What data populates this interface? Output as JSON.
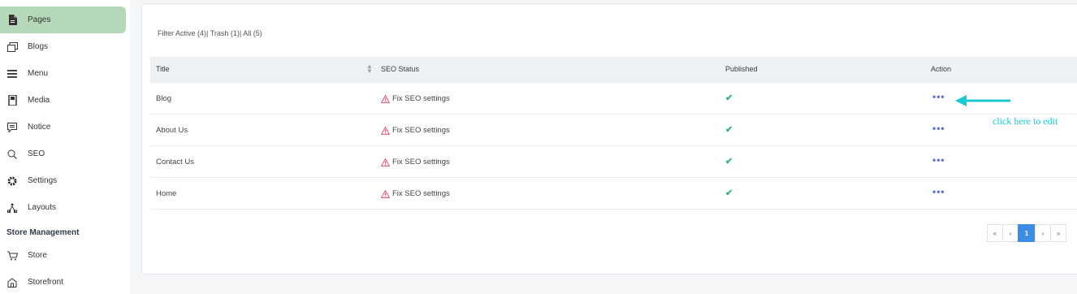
{
  "sidebar": {
    "items": [
      {
        "label": "Pages",
        "icon": "file-icon",
        "active": true
      },
      {
        "label": "Blogs",
        "icon": "copy-icon",
        "active": false
      },
      {
        "label": "Menu",
        "icon": "hamburger-icon",
        "active": false
      },
      {
        "label": "Media",
        "icon": "media-file-icon",
        "active": false
      },
      {
        "label": "Notice",
        "icon": "notice-icon",
        "active": false
      },
      {
        "label": "SEO",
        "icon": "search-icon",
        "active": false
      },
      {
        "label": "Settings",
        "icon": "gear-icon",
        "active": false
      },
      {
        "label": "Layouts",
        "icon": "layouts-icon",
        "active": false
      }
    ],
    "section_title": "Store Management",
    "store_items": [
      {
        "label": "Store",
        "icon": "cart-icon"
      },
      {
        "label": "Storefront",
        "icon": "storefront-icon"
      }
    ],
    "active_color": "#b5d8b8"
  },
  "filter": {
    "prefix": "Filter",
    "active": "Active (4)",
    "trash": "Trash (1)",
    "all": "All (5)"
  },
  "table": {
    "headers": {
      "title": "Title",
      "seo": "SEO Status",
      "published": "Published",
      "action": "Action"
    },
    "rows": [
      {
        "title": "Blog",
        "seo": "Fix SEO settings",
        "published": "✔",
        "action": "•••"
      },
      {
        "title": "About Us",
        "seo": "Fix SEO settings",
        "published": "✔",
        "action": "•••"
      },
      {
        "title": "Contact Us",
        "seo": "Fix SEO settings",
        "published": "✔",
        "action": "•••"
      },
      {
        "title": "Home",
        "seo": "Fix SEO settings",
        "published": "✔",
        "action": "•••"
      }
    ]
  },
  "pagination": {
    "first": "«",
    "prev": "‹",
    "current": "1",
    "next": "›",
    "last": "»"
  },
  "annotation": {
    "text": "click here to edit",
    "color": "#18c9d3"
  },
  "colors": {
    "warning": "#e0506b",
    "check": "#2bb673",
    "accent": "#3b8ee8"
  }
}
